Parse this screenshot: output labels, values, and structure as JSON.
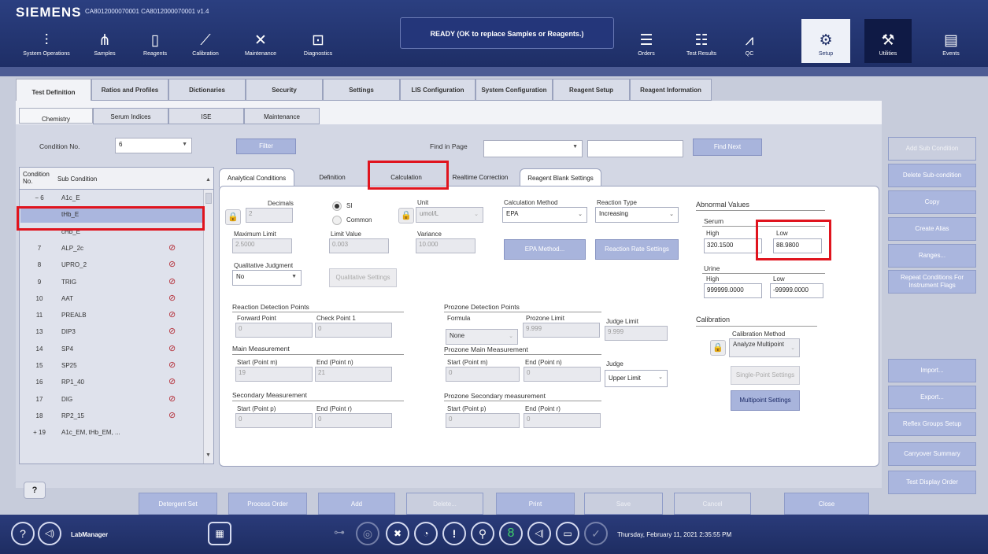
{
  "header": {
    "brand": "SIEMENS",
    "identity": "CA8012000070001 CA8012000070001 v1.4",
    "status": "READY (OK to replace Samples or Reagents.)",
    "nav": [
      {
        "label": "System Operations",
        "icon": "system-operations-icon"
      },
      {
        "label": "Samples",
        "icon": "samples-icon"
      },
      {
        "label": "Reagents",
        "icon": "reagents-icon"
      },
      {
        "label": "Calibration",
        "icon": "calibration-icon"
      },
      {
        "label": "Maintenance",
        "icon": "maintenance-icon"
      },
      {
        "label": "Diagnostics",
        "icon": "diagnostics-icon"
      },
      {
        "label": "Orders",
        "icon": "orders-icon"
      },
      {
        "label": "Test Results",
        "icon": "test-results-icon"
      },
      {
        "label": "QC",
        "icon": "qc-icon"
      },
      {
        "label": "Setup",
        "icon": "setup-icon"
      },
      {
        "label": "Utilities",
        "icon": "utilities-icon"
      },
      {
        "label": "Events",
        "icon": "events-icon"
      }
    ]
  },
  "tabs": [
    "Test Definition",
    "Ratios and Profiles",
    "Dictionaries",
    "Security",
    "Settings",
    "LIS Configuration",
    "System Configuration",
    "Reagent Setup",
    "Reagent Information"
  ],
  "subtabs": [
    "Chemistry",
    "Serum Indices",
    "ISE",
    "Maintenance"
  ],
  "filterbar": {
    "condition_label": "Condition No.",
    "condition_value": "6",
    "filter": "Filter",
    "find_label": "Find in Page",
    "find_next": "Find Next"
  },
  "list": {
    "col_no": "Condition No.",
    "col_sub": "Sub Condition",
    "rows": [
      {
        "no": "−  6",
        "name": "A1c_E",
        "banned": false
      },
      {
        "no": "",
        "name": "tHb_E",
        "banned": false
      },
      {
        "no": "",
        "name": "cHb_E",
        "banned": false
      },
      {
        "no": "7",
        "name": "ALP_2c",
        "banned": true
      },
      {
        "no": "8",
        "name": "UPRO_2",
        "banned": true
      },
      {
        "no": "9",
        "name": "TRIG",
        "banned": true
      },
      {
        "no": "10",
        "name": "AAT",
        "banned": true
      },
      {
        "no": "11",
        "name": "PREALB",
        "banned": true
      },
      {
        "no": "13",
        "name": "DIP3",
        "banned": true
      },
      {
        "no": "14",
        "name": "SP4",
        "banned": true
      },
      {
        "no": "15",
        "name": "SP25",
        "banned": true
      },
      {
        "no": "16",
        "name": "RP1_40",
        "banned": true
      },
      {
        "no": "17",
        "name": "DIG",
        "banned": true
      },
      {
        "no": "18",
        "name": "RP2_15",
        "banned": true
      },
      {
        "no": "+  19",
        "name": "A1c_EM, tHb_EM, ...",
        "banned": false
      }
    ]
  },
  "detail_tabs": [
    "Analytical Conditions",
    "Definition",
    "Calculation",
    "Realtime Correction",
    "Reagent Blank Settings"
  ],
  "calc": {
    "decimals_label": "Decimals",
    "decimals": "2",
    "si": "SI",
    "common": "Common",
    "unit_label": "Unit",
    "unit": "umol/L",
    "calc_method_label": "Calculation Method",
    "calc_method": "EPA",
    "reaction_type_label": "Reaction Type",
    "reaction_type": "Increasing",
    "max_limit_label": "Maximum Limit",
    "max_limit": "2.5000",
    "limit_value_label": "Limit Value",
    "limit_value": "0.003",
    "variance_label": "Variance",
    "variance": "10.000",
    "epa_method": "EPA Method...",
    "reaction_rate": "Reaction Rate Settings",
    "qual_label": "Qualitative Judgment",
    "qual": "No",
    "qual_settings": "Qualitative Settings",
    "rdp_title": "Reaction Detection Points",
    "forward_label": "Forward Point",
    "forward": "0",
    "check_label": "Check Point 1",
    "check": "0",
    "main_title": "Main Measurement",
    "start_m_label": "Start (Point m)",
    "start_m": "19",
    "end_n_label": "End (Point n)",
    "end_n": "21",
    "sec_title": "Secondary Measurement",
    "start_p_label": "Start (Point p)",
    "start_p": "0",
    "end_r_label": "End (Point r)",
    "end_r": "0",
    "pdp_title": "Prozone Detection Points",
    "formula_label": "Formula",
    "formula": "None",
    "prozone_limit_label": "Prozone Limit",
    "prozone_limit": "9.999",
    "judge_limit_label": "Judge Limit",
    "judge_limit": "9.999",
    "pmain_title": "Prozone Main Measurement",
    "pstart_m": "0",
    "pend_n": "0",
    "judge_label": "Judge",
    "judge": "Upper Limit",
    "psec_title": "Prozone Secondary measurement",
    "pstart_p": "0",
    "pend_r": "0",
    "abn_title": "Abnormal Values",
    "serum": "Serum",
    "high_label": "High",
    "low_label": "Low",
    "serum_high": "320.1500",
    "serum_low": "88.9800",
    "urine": "Urine",
    "urine_high": "999999.0000",
    "urine_low": "-99999.0000",
    "cal_title": "Calibration",
    "cal_method_label": "Calibration Method",
    "cal_method": "Analyze Multipoint",
    "single_point": "Single-Point Settings",
    "multipoint": "Multipoint Settings"
  },
  "side": [
    "Add Sub Condition",
    "Delete Sub-condition",
    "Copy",
    "Create Alias",
    "Ranges...",
    "Repeat Conditions For Instrument Flags",
    "Import...",
    "Export...",
    "Reflex Groups Setup",
    "Carryover Summary",
    "Test Display Order"
  ],
  "bottom": [
    "Detergent Set",
    "Process Order",
    "Add",
    "Delete...",
    "Print",
    "Save",
    "Cancel",
    "Close"
  ],
  "help": "?",
  "footer": {
    "user": "LabManager",
    "datetime": "Thursday, February 11, 2021 2:35:55 PM"
  }
}
